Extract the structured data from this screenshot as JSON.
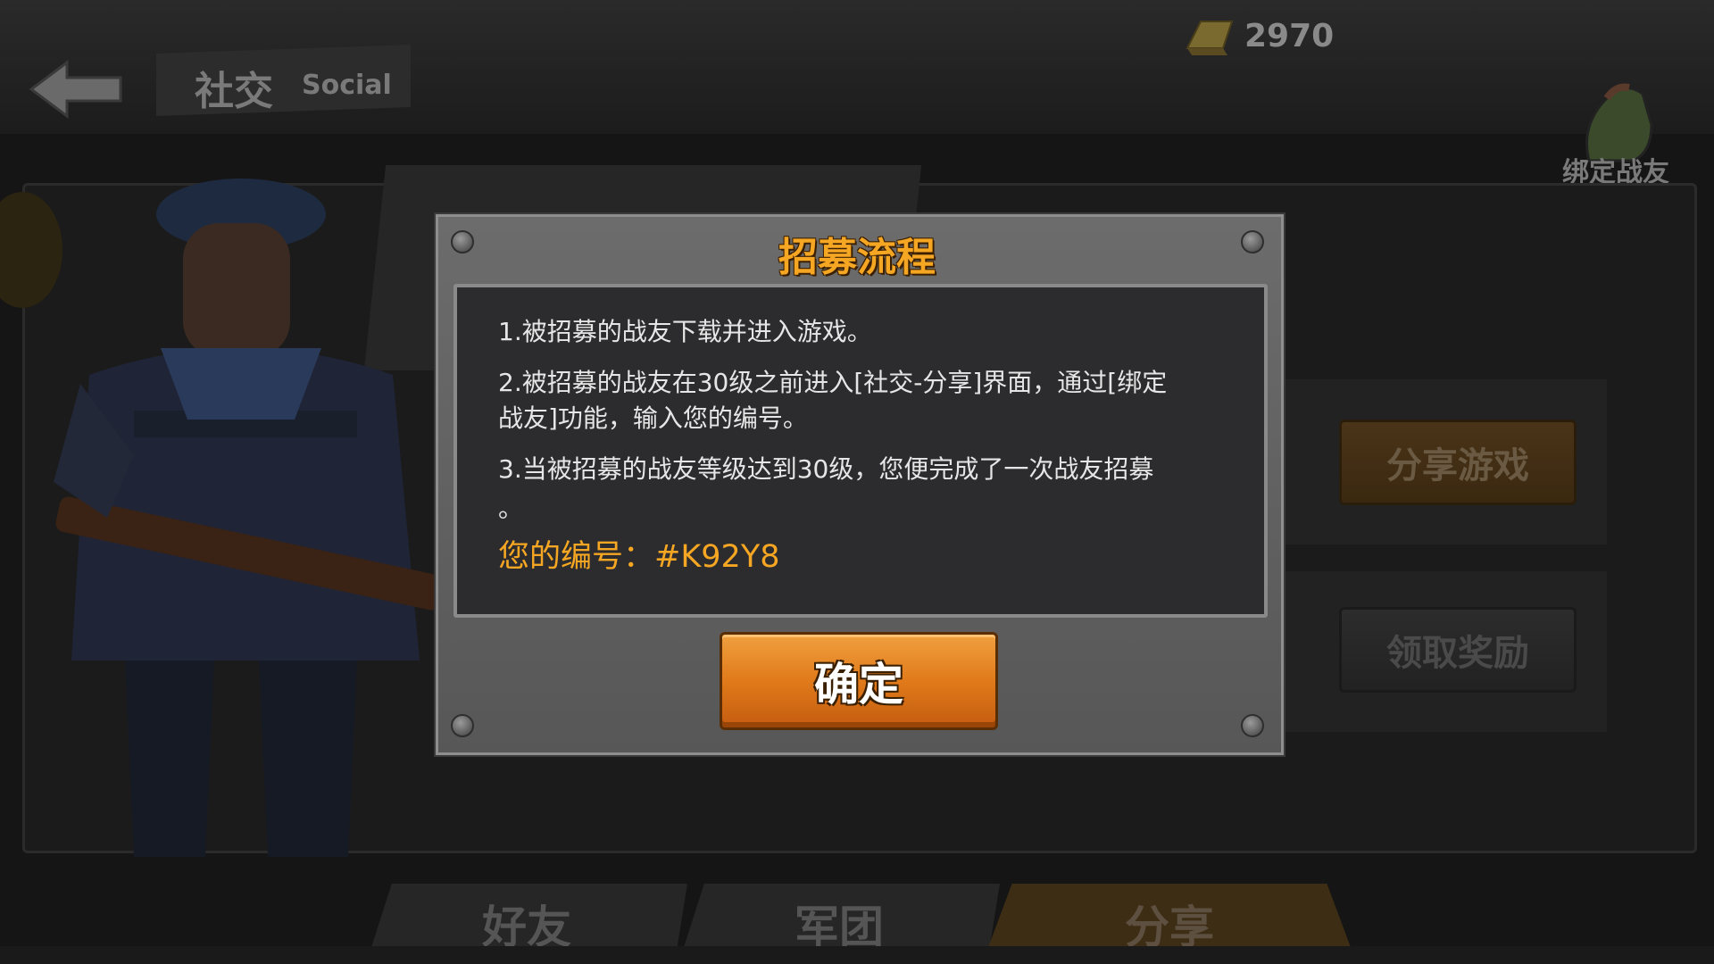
{
  "header": {
    "title_cn": "社交",
    "title_en": "Social",
    "gold": "2970",
    "bind_label": "绑定战友"
  },
  "side": {
    "share_game": "分享游戏",
    "claim_reward": "领取奖励"
  },
  "tabs": [
    {
      "label": "好友",
      "active": false
    },
    {
      "label": "军团",
      "active": false
    },
    {
      "label": "分享",
      "active": true
    }
  ],
  "modal": {
    "title": "招募流程",
    "lines": [
      "1.被招募的战友下载并进入游戏。",
      "2.被招募的战友在30级之前进入[社交-分享]界面，通过[绑定",
      "战友]功能，输入您的编号。",
      "3.当被招募的战友等级达到30级，您便完成了一次战友招募",
      "。"
    ],
    "code": "您的编号：#K92Y8",
    "confirm": "确定"
  },
  "colors": {
    "accent": "#f5a623",
    "confirm_button": "#e07a1a",
    "modal_bg": "#616161",
    "content_bg": "#2c2c2e"
  }
}
